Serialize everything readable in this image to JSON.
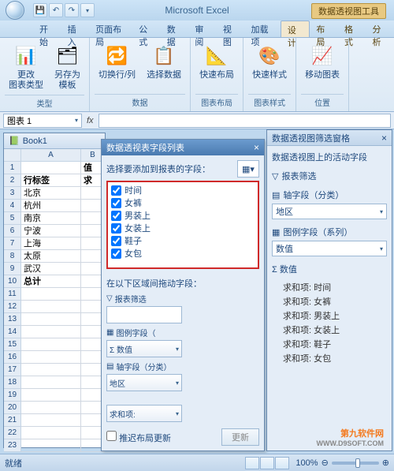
{
  "app_title": "Microsoft Excel",
  "context_title": "数据透视图工具",
  "tabs": {
    "home": "开始",
    "insert": "插入",
    "layout": "页面布局",
    "formula": "公式",
    "data": "数据",
    "review": "审阅",
    "view": "视图",
    "addin": "加载项",
    "design": "设计",
    "layout2": "布局",
    "format": "格式",
    "analyze": "分析"
  },
  "ribbon": {
    "g1": {
      "btn1": "更改\n图表类型",
      "btn2": "另存为\n模板",
      "label": "类型"
    },
    "g2": {
      "btn1": "切换行/列",
      "btn2": "选择数据",
      "label": "数据"
    },
    "g3": {
      "btn1": "快速布局",
      "label": "图表布局"
    },
    "g4": {
      "btn1": "快速样式",
      "label": "图表样式"
    },
    "g5": {
      "btn1": "移动图表",
      "label": "位置"
    }
  },
  "name_box": "图表 1",
  "workbook_title": "Book1",
  "sheet": {
    "colA": "A",
    "colB": "B",
    "r1_b": "值",
    "r2_a": "行标签",
    "r2_b": "求",
    "rows": [
      "北京",
      "杭州",
      "南京",
      "宁波",
      "上海",
      "太原",
      "武汉"
    ],
    "total": "总计"
  },
  "field_pane": {
    "title": "数据透视表字段列表",
    "instr": "选择要添加到报表的字段：",
    "fields": [
      "时间",
      "女裤",
      "男装上",
      "女装上",
      "鞋子",
      "女包"
    ],
    "drag_instr": "在以下区域间拖动字段：",
    "zone1": "报表筛选",
    "zone2": "图例字段（",
    "zone2_val": "Σ 数值",
    "zone3": "轴字段（分类）",
    "zone3_val": "地区",
    "zone4_val": "求和项:",
    "defer": "推迟布局更新",
    "update": "更新"
  },
  "filter_pane": {
    "title": "数据透视图筛选窗格",
    "sub": "数据透视图上的活动字段",
    "s1": "报表筛选",
    "s2": "轴字段（分类）",
    "s2_val": "地区",
    "s3": "图例字段（系列）",
    "s3_val": "数值",
    "sigma": "Σ 数值",
    "vals": [
      "求和项: 时间",
      "求和项: 女裤",
      "求和项: 男装上",
      "求和项: 女装上",
      "求和项: 鞋子",
      "求和项: 女包"
    ]
  },
  "status": "就绪",
  "zoom": "100%",
  "watermark": {
    "name": "第九软件网",
    "url": "WWW.D9SOFT.COM"
  }
}
